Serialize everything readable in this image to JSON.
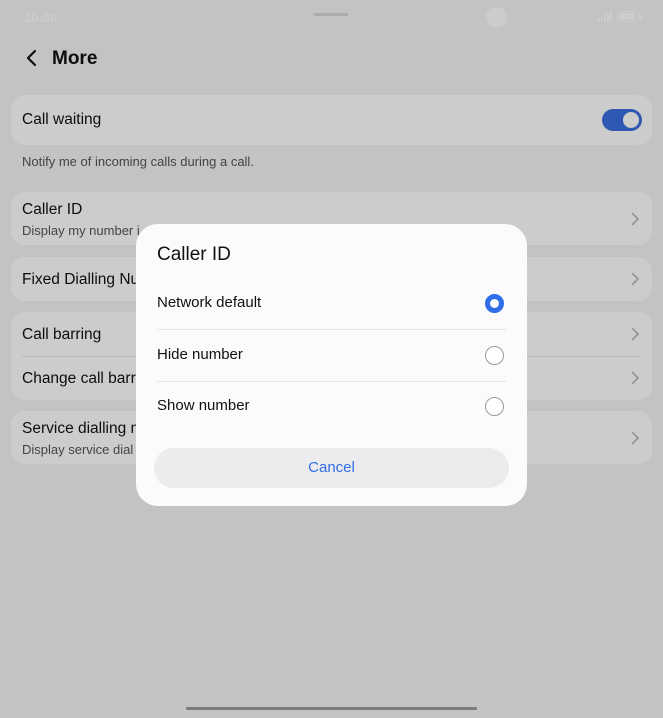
{
  "status_bar": {
    "time": "10:00"
  },
  "header": {
    "title": "More"
  },
  "call_waiting": {
    "label": "Call waiting",
    "enabled": true,
    "note": "Notify me of incoming calls during a call."
  },
  "settings": {
    "caller_id": {
      "title": "Caller ID",
      "subtitle": "Display my number i"
    },
    "fixed_dialling": {
      "title": "Fixed Dialling Nu"
    },
    "call_barring": {
      "title": "Call barring"
    },
    "change_barring": {
      "title": "Change call barr"
    },
    "service_dialling": {
      "title": "Service dialling n",
      "subtitle": "Display service dial"
    }
  },
  "dialog": {
    "title": "Caller ID",
    "options": [
      {
        "label": "Network default",
        "selected": true
      },
      {
        "label": "Hide number",
        "selected": false
      },
      {
        "label": "Show number",
        "selected": false
      }
    ],
    "cancel_label": "Cancel"
  },
  "colors": {
    "accent": "#2f6ee8",
    "toggle_on": "#3a6fe0"
  },
  "icons": {
    "back": "back-arrow-icon",
    "chevron": "chevron-right-icon",
    "signal": "signal-icon",
    "battery": "battery-icon"
  }
}
